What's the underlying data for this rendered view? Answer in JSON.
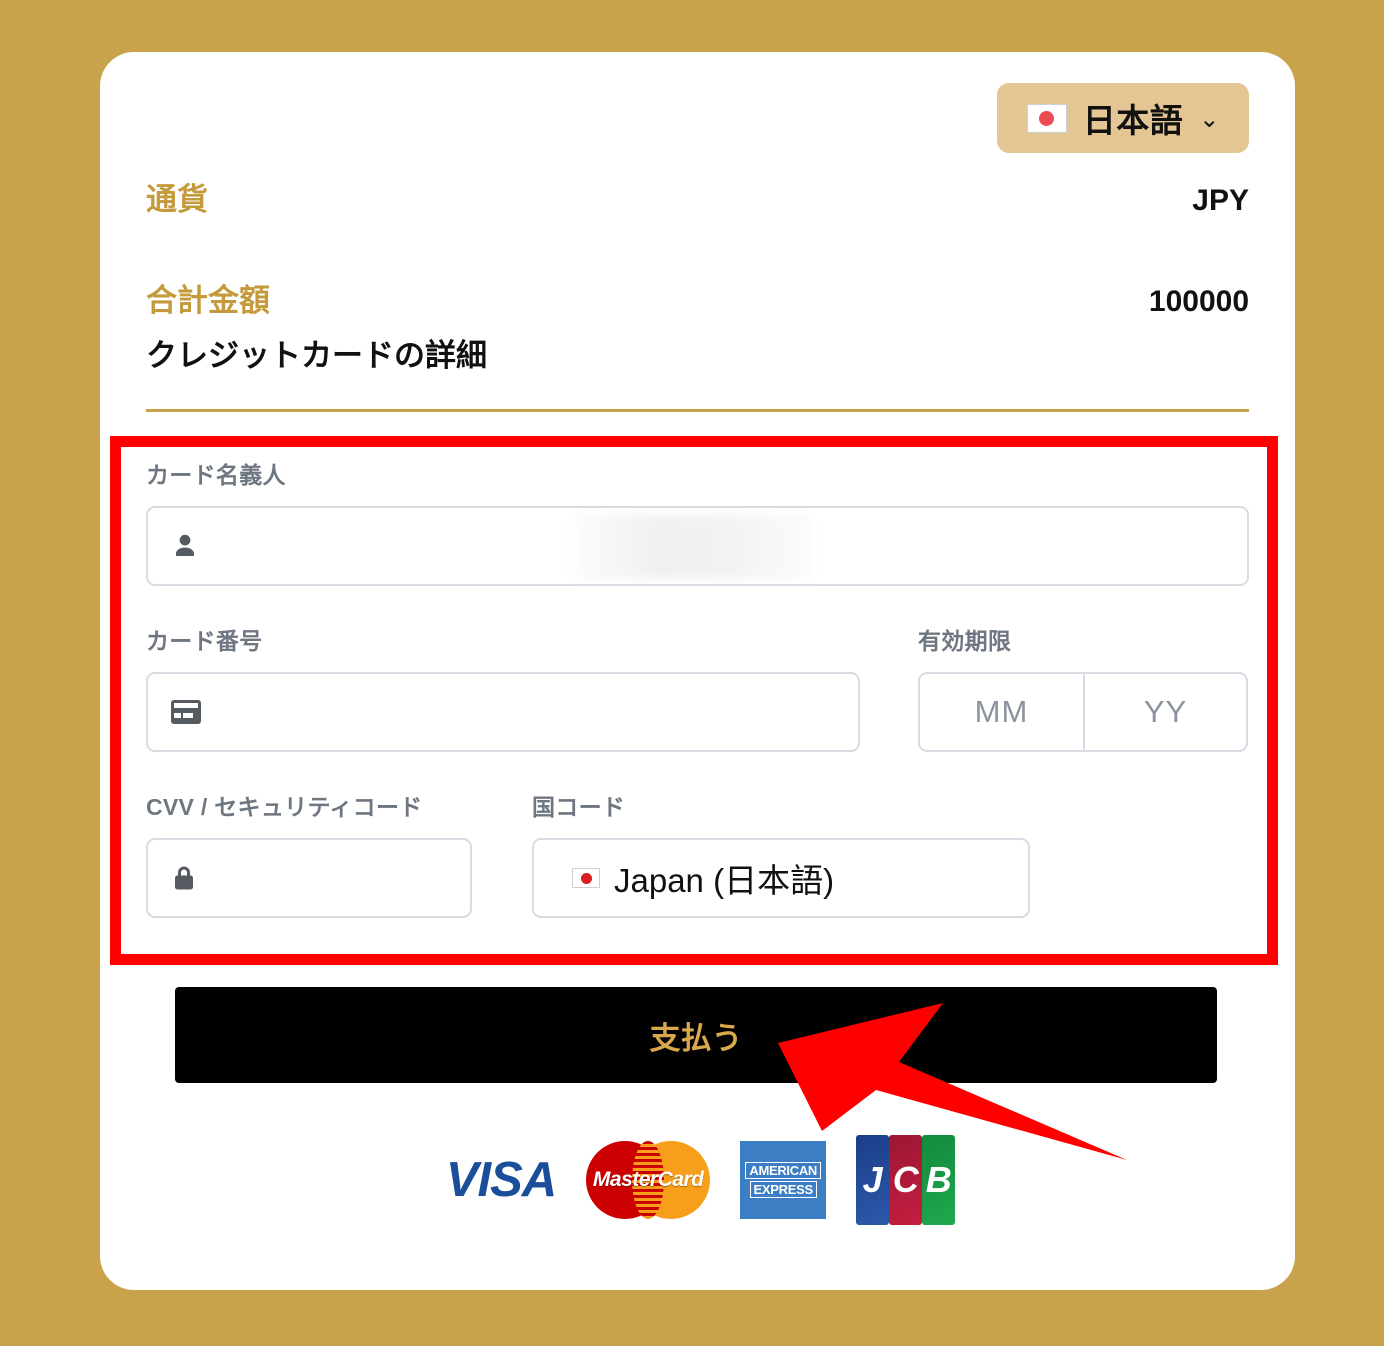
{
  "language_selector": {
    "label": "日本語",
    "flag_icon": "japan-flag-icon",
    "chevron_icon": "chevron-down-icon"
  },
  "summary": {
    "currency_label": "通貨",
    "currency_value": "JPY",
    "total_label": "合計金額",
    "total_value": "100000"
  },
  "section": {
    "title": "クレジットカードの詳細"
  },
  "form": {
    "cardholder": {
      "label": "カード名義人",
      "value": "",
      "placeholder": "",
      "icon": "person-icon",
      "redacted": true
    },
    "card_number": {
      "label": "カード番号",
      "value": "",
      "placeholder": "",
      "icon": "credit-card-icon"
    },
    "expiry": {
      "label": "有効期限",
      "month_placeholder": "MM",
      "year_placeholder": "YY",
      "month_value": "",
      "year_value": ""
    },
    "cvv": {
      "label": "CVV / セキュリティコード",
      "value": "",
      "placeholder": "",
      "icon": "lock-icon"
    },
    "country": {
      "label": "国コード",
      "value": "Japan (日本語)",
      "flag_icon": "japan-flag-icon"
    }
  },
  "pay_button": {
    "label": "支払う"
  },
  "brands": [
    {
      "name": "VISA",
      "id": "visa-logo"
    },
    {
      "name": "MasterCard",
      "id": "mastercard-logo"
    },
    {
      "name": "AMERICAN EXPRESS",
      "id": "amex-logo"
    },
    {
      "name": "JCB",
      "id": "jcb-logo"
    }
  ],
  "annotations": {
    "highlight_box_color": "#FF0000",
    "arrow_color": "#FF0000"
  },
  "colors": {
    "page_background": "#C9A24C",
    "card_background": "#FFFFFF",
    "accent_gold": "#C49A3C",
    "language_button": "#E3C694",
    "pay_button_background": "#000000",
    "pay_button_text": "#D9A84B",
    "input_border": "#D7DCE3",
    "label_text": "#6E7781"
  }
}
